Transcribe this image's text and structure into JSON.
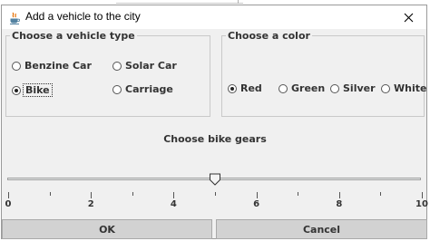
{
  "window": {
    "title": "Add a vehicle to the city"
  },
  "vehicle_group": {
    "legend": "Choose a vehicle type",
    "options": [
      {
        "label": "Benzine Car",
        "selected": false
      },
      {
        "label": "Solar Car",
        "selected": false
      },
      {
        "label": "Bike",
        "selected": true
      },
      {
        "label": "Carriage",
        "selected": false
      }
    ]
  },
  "color_group": {
    "legend": "Choose a color",
    "options": [
      {
        "label": "Red",
        "selected": true
      },
      {
        "label": "Green",
        "selected": false
      },
      {
        "label": "Silver",
        "selected": false
      },
      {
        "label": "White",
        "selected": false
      }
    ]
  },
  "gears": {
    "title": "Choose bike gears",
    "min": 0,
    "max": 10,
    "value": 5,
    "major_labels": [
      "0",
      "2",
      "4",
      "6",
      "8",
      "10"
    ]
  },
  "buttons": {
    "ok": "OK",
    "cancel": "Cancel"
  },
  "icons": {
    "app": "java-app-icon",
    "close": "close-icon",
    "thumb": "slider-thumb"
  },
  "colors": {
    "dialog_bg": "#f0f0f0",
    "button_bg": "#d2d2d2",
    "group_border": "#c9c9c9"
  }
}
